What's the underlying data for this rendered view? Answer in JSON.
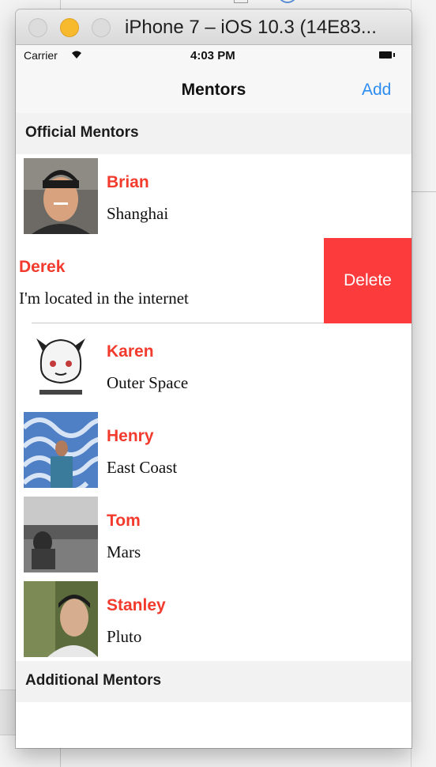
{
  "window": {
    "title": "iPhone 7 – iOS 10.3 (14E83..."
  },
  "statusbar": {
    "carrier": "Carrier",
    "time": "4:03 PM"
  },
  "navbar": {
    "title": "Mentors",
    "add_label": "Add"
  },
  "sections": {
    "official": "Official Mentors",
    "additional": "Additional Mentors"
  },
  "mentors": [
    {
      "name": "Brian",
      "location": "Shanghai"
    },
    {
      "name": "Derek",
      "location": "I'm located in the internet"
    },
    {
      "name": "Karen",
      "location": "Outer Space"
    },
    {
      "name": "Henry",
      "location": "East Coast"
    },
    {
      "name": "Tom",
      "location": "Mars"
    },
    {
      "name": "Stanley",
      "location": "Pluto"
    }
  ],
  "delete_label": "Delete",
  "colors": {
    "accent_name": "#f23a2d",
    "delete_bg": "#fb3b3c",
    "link_blue": "#2d8cf0"
  }
}
